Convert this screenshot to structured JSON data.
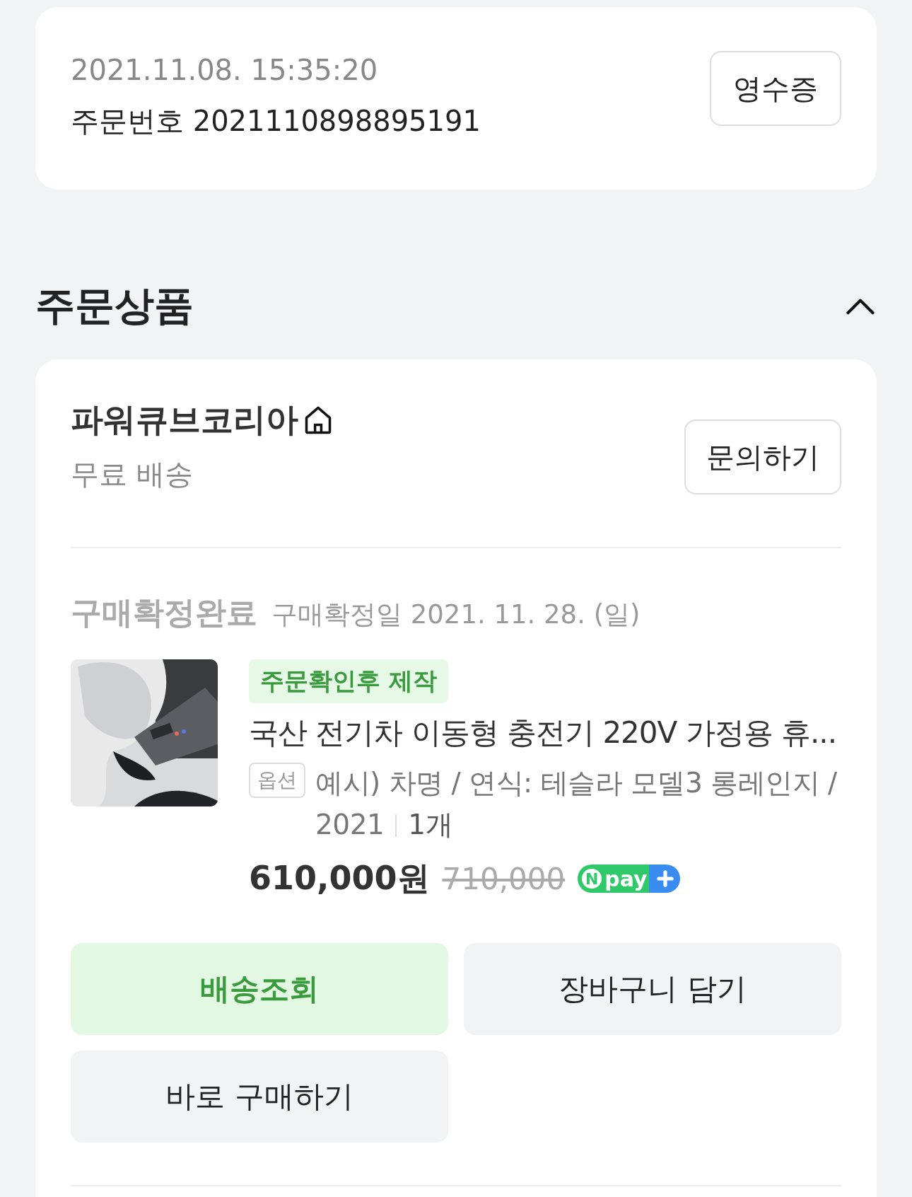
{
  "order_card": {
    "datetime": "2021.11.08. 15:35:20",
    "order_number": "주문번호 2021110898895191",
    "receipt_button": "영수증"
  },
  "section": {
    "title": "주문상품",
    "expanded": true
  },
  "seller": {
    "name": "파워큐브코리아",
    "shipping": "무료 배송",
    "inquiry_button": "문의하기"
  },
  "item": {
    "status": "구매확정완료",
    "confirm_date": "구매확정일 2021. 11. 28. (일)",
    "tag": "주문확인후 제작",
    "title": "국산 전기차 이동형 충전기 220V 가정용 휴...",
    "option_label": "옵션",
    "option_text": "예시) 차명 / 연식: 테슬라 모델3 롱레인지 / 2021",
    "quantity": "1개",
    "price": "610,000원",
    "original_price": "710,000",
    "npay": {
      "mark": "N",
      "label": "pay"
    }
  },
  "actions": [
    {
      "label": "배송조회",
      "kind": "primary"
    },
    {
      "label": "장바구니 담기",
      "kind": "default"
    },
    {
      "label": "바로 구매하기",
      "kind": "default"
    }
  ]
}
